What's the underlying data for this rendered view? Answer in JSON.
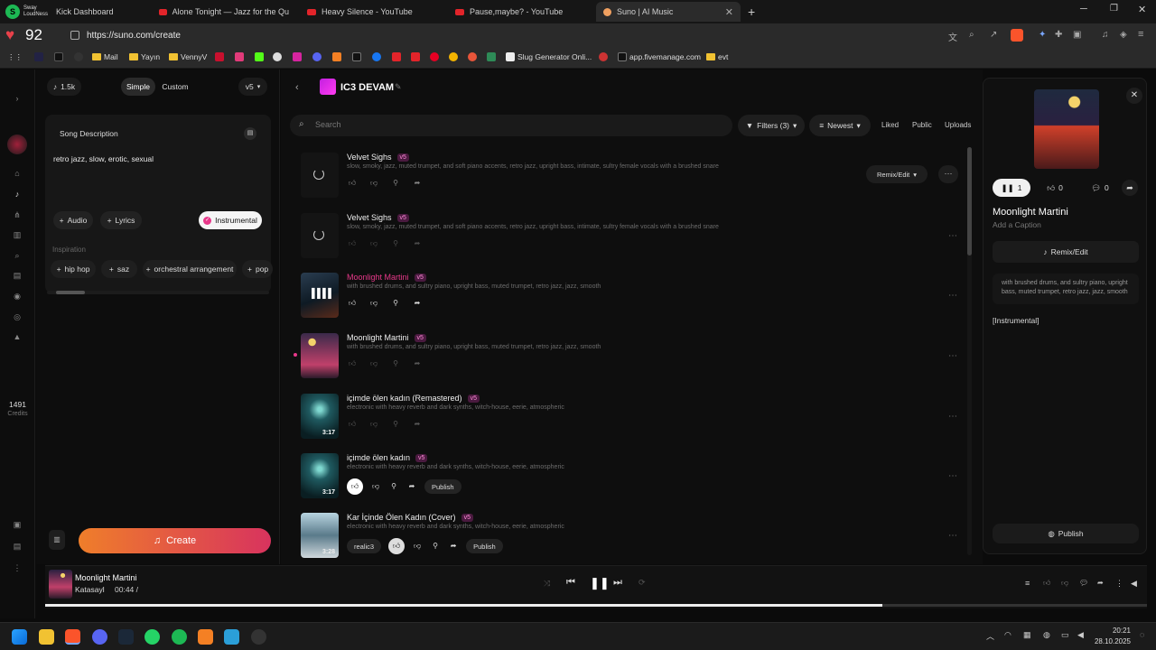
{
  "browser": {
    "profile_label": "Sway LoudNess",
    "tabs": [
      {
        "title": "Kick Dashboard"
      },
      {
        "title": "Alone Tonight — Jazz for the Qu"
      },
      {
        "title": "Heavy Silence - YouTube"
      },
      {
        "title": "Pause,maybe? - YouTube"
      },
      {
        "title": "Suno | AI Music"
      }
    ],
    "heart_count": "92",
    "url": "https://suno.com/create",
    "bookmarks": [
      "Mail",
      "Yayın",
      "VennyV",
      "Slug Generator Onli...",
      "app.fivemanage.com",
      "evt"
    ]
  },
  "rail": {
    "credits_value": "1491",
    "credits_label": "Credits"
  },
  "left_panel": {
    "count": "1.5k",
    "mode_simple": "Simple",
    "mode_custom": "Custom",
    "version": "v5",
    "song_description_label": "Song Description",
    "song_description_value": "retro jazz, slow, erotic, sexual",
    "audio_label": "Audio",
    "lyrics_label": "Lyrics",
    "instrumental_label": "Instrumental",
    "inspiration_label": "Inspiration",
    "inspiration_tags": [
      "hip hop",
      "saz",
      "orchestral arrangement",
      "pop"
    ],
    "create_label": "Create"
  },
  "workspace": {
    "title": "IC3 DEVAM",
    "search_placeholder": "Search",
    "filters_label": "Filters (3)",
    "sort_label": "Newest",
    "liked": "Liked",
    "public": "Public",
    "uploads": "Uploads",
    "remix_label": "Remix/Edit",
    "publish_label": "Publish"
  },
  "songs": [
    {
      "title": "Velvet Sighs",
      "badge": "v5",
      "desc": "slow, smoky, jazz, muted trumpet, and soft piano accents, retro jazz, upright bass, intimate, sultry female vocals with a brushed snare",
      "duration": ""
    },
    {
      "title": "Velvet Sighs",
      "badge": "v5",
      "desc": "slow, smoky, jazz, muted trumpet, and soft piano accents, retro jazz, upright bass, intimate, sultry female vocals with a brushed snare",
      "duration": ""
    },
    {
      "title": "Moonlight Martini",
      "badge": "v5",
      "desc": "with brushed drums, and sultry piano, upright bass, muted trumpet, retro jazz, jazz, smooth",
      "duration": ""
    },
    {
      "title": "Moonlight Martini",
      "badge": "v5",
      "desc": "with brushed drums, and sultry piano, upright bass, muted trumpet, retro jazz, jazz, smooth",
      "duration": ""
    },
    {
      "title": "içimde ölen kadın (Remastered)",
      "badge": "v5",
      "desc": "electronic with heavy reverb and dark synths, witch-house, eerie, atmospheric",
      "duration": "3:17"
    },
    {
      "title": "içimde ölen kadın",
      "badge": "v5",
      "desc": "electronic with heavy reverb and dark synths, witch-house, eerie, atmospheric",
      "duration": "3:17"
    },
    {
      "title": "Kar İçinde Ölen Kadın (Cover)",
      "badge": "v5",
      "desc": "electronic with heavy reverb and dark synths, witch-house, eerie, atmospheric",
      "duration": "3:28",
      "artist": "realic3"
    }
  ],
  "right_panel": {
    "likes": "0",
    "comments": "0",
    "plays": "1",
    "title": "Moonlight Martini",
    "caption_placeholder": "Add a Caption",
    "remix_label": "Remix/Edit",
    "description": "with brushed drums, and sultry piano, upright bass, muted trumpet, retro jazz, jazz, smooth",
    "tag": "[Instrumental]",
    "publish_label": "Publish"
  },
  "player": {
    "title": "Moonlight Martini",
    "artist": "Katasayl",
    "time": "00:44 /",
    "progress": 0.76
  },
  "taskbar": {
    "time": "20:21",
    "date": "28.10.2025"
  },
  "colors": {
    "accent": "#e8388a",
    "create_gradient_start": "#ef7e2a",
    "create_gradient_end": "#d8335e"
  }
}
